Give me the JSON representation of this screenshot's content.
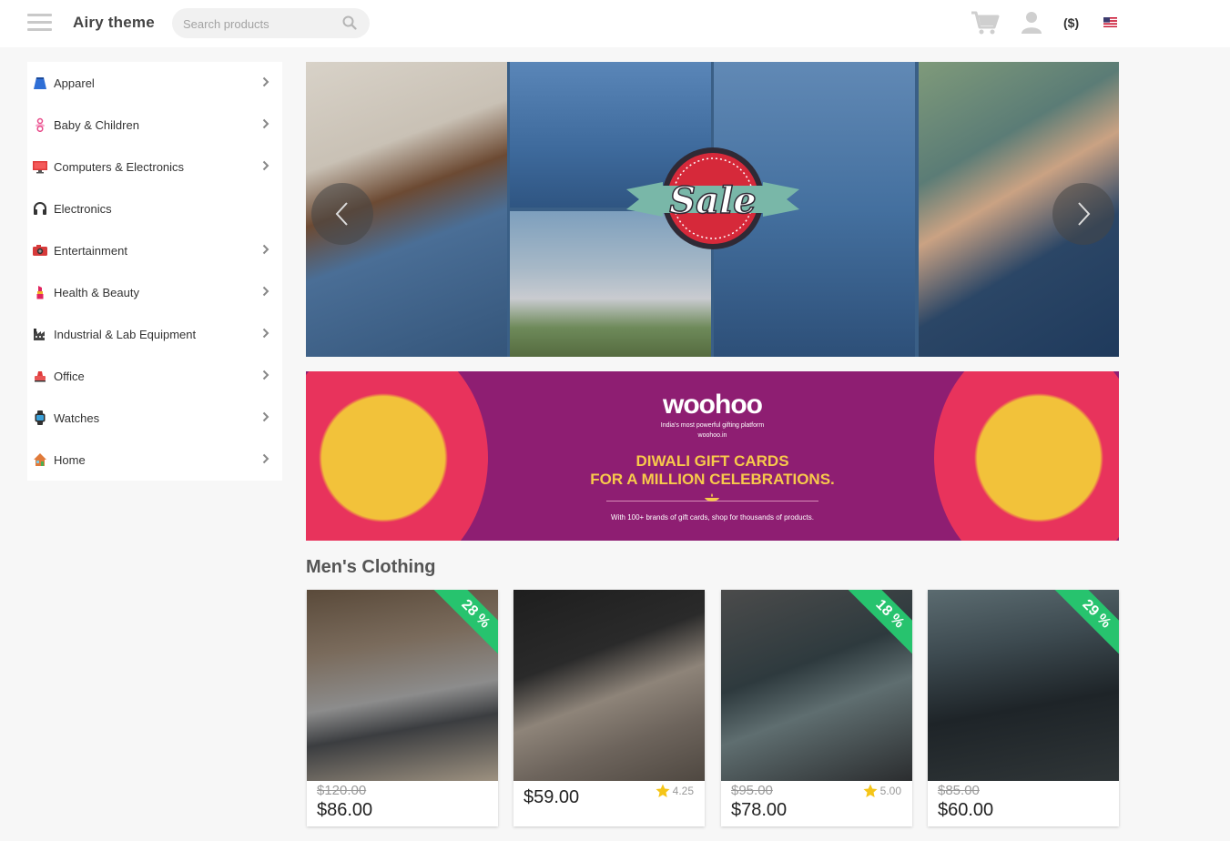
{
  "header": {
    "brand": "Airy theme",
    "search_placeholder": "Search products",
    "currency": "($)"
  },
  "sidebar": {
    "items": [
      {
        "label": "Apparel",
        "icon": "skirt-icon",
        "has_submenu": true
      },
      {
        "label": "Baby & Children",
        "icon": "pacifier-icon",
        "has_submenu": true
      },
      {
        "label": "Computers & Electronics",
        "icon": "monitor-icon",
        "has_submenu": true
      },
      {
        "label": "Electronics",
        "icon": "headphones-icon",
        "has_submenu": false
      },
      {
        "label": "Entertainment",
        "icon": "camera-icon",
        "has_submenu": true
      },
      {
        "label": "Health & Beauty",
        "icon": "lipstick-icon",
        "has_submenu": true
      },
      {
        "label": "Industrial & Lab Equipment",
        "icon": "factory-icon",
        "has_submenu": true
      },
      {
        "label": "Office",
        "icon": "stapler-icon",
        "has_submenu": true
      },
      {
        "label": "Watches",
        "icon": "watch-icon",
        "has_submenu": true
      },
      {
        "label": "Home",
        "icon": "house-icon",
        "has_submenu": true
      }
    ]
  },
  "carousel": {
    "badge_text": "Sale"
  },
  "promo": {
    "brand": "woohoo",
    "tagline": "India's most powerful gifting platform",
    "app_line": "woohoo.in",
    "headline_1": "DIWALI GIFT CARDS",
    "headline_2": "FOR A MILLION CELEBRATIONS.",
    "footer": "With 100+ brands of gift cards, shop for thousands of products."
  },
  "section": {
    "title": "Men's Clothing"
  },
  "products": [
    {
      "discount": "28 %",
      "old_price": "$120.00",
      "price": "$86.00",
      "rating": ""
    },
    {
      "discount": "",
      "old_price": "",
      "price": "$59.00",
      "rating": "4.25"
    },
    {
      "discount": "18 %",
      "old_price": "$95.00",
      "price": "$78.00",
      "rating": "5.00"
    },
    {
      "discount": "29 %",
      "old_price": "$85.00",
      "price": "$60.00",
      "rating": ""
    }
  ],
  "colors": {
    "accent_green": "#27c36e",
    "promo_purple": "#8e1e72",
    "promo_yellow": "#f8c94b",
    "sale_red": "#d6293a"
  }
}
